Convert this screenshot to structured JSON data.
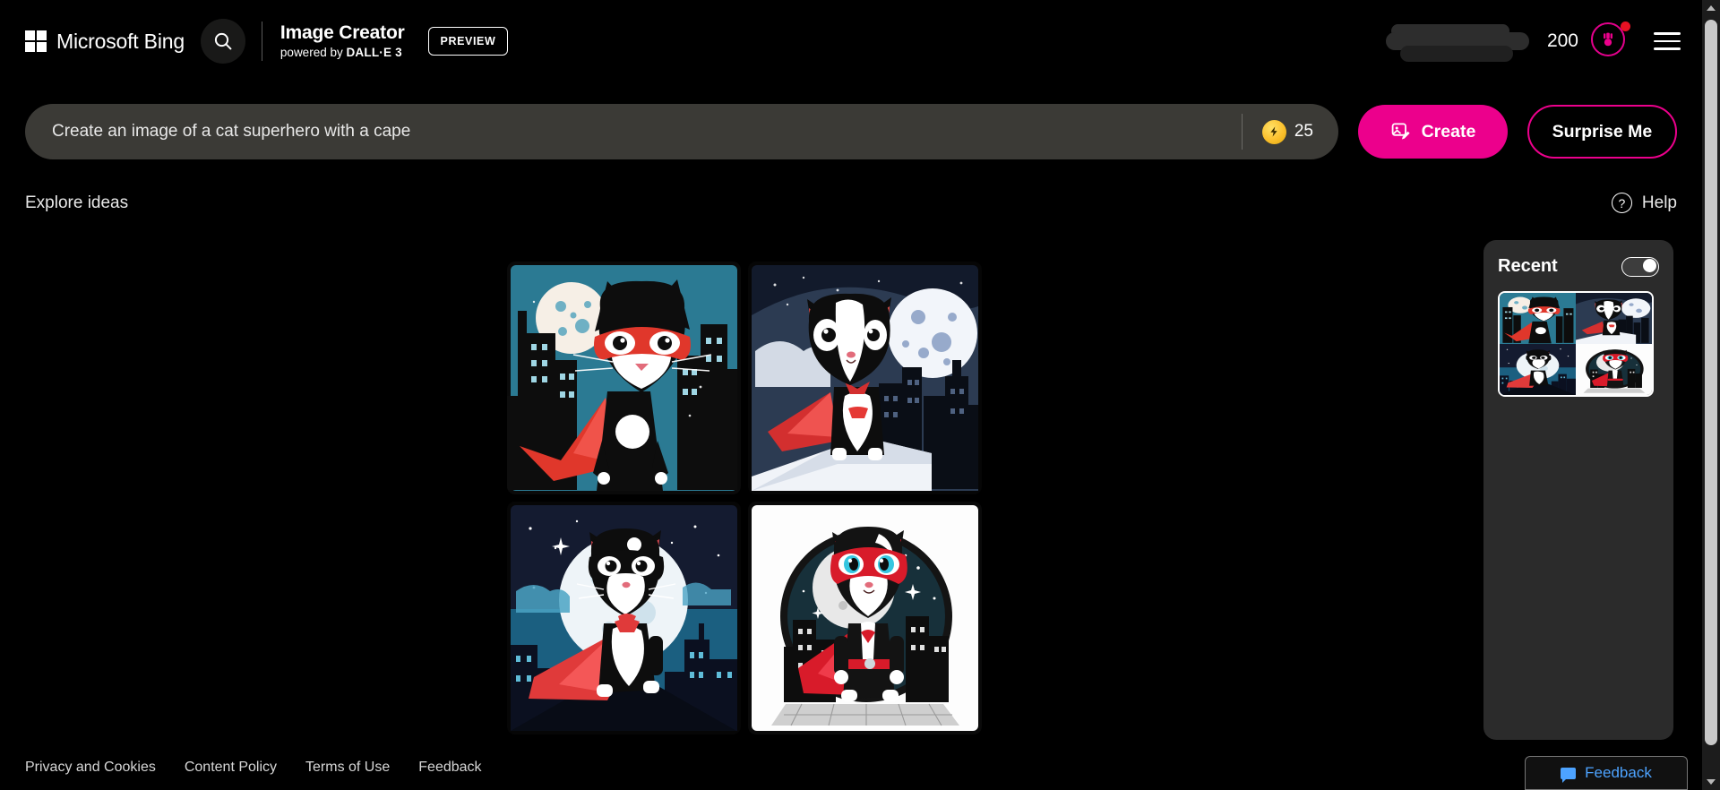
{
  "header": {
    "brand": "Microsoft Bing",
    "app_title": "Image Creator",
    "app_subtitle_prefix": "powered by ",
    "app_subtitle_strong": "DALL·E 3",
    "preview_badge": "PREVIEW",
    "credits": "200",
    "search_icon": "search-icon",
    "rewards_icon": "rewards-medal-icon",
    "menu_icon": "hamburger-menu-icon",
    "user_name_redacted": ""
  },
  "prompt": {
    "value": "Create an image of a cat superhero with a cape",
    "placeholder": "Create an image of a cat superhero with a cape",
    "boost_count": "25",
    "boost_icon": "lightning-boost-coin-icon",
    "create_label": "Create",
    "create_icon": "image-pen-icon",
    "surprise_label": "Surprise Me"
  },
  "explore": {
    "title": "Explore ideas",
    "help_label": "Help",
    "help_icon": "question-circle-icon"
  },
  "results": {
    "tiles": [
      {
        "alt": "Teal city night, masked cat superhero with red cape and full moon",
        "theme": "teal"
      },
      {
        "alt": "Tuxedo cat superhero on rooftop with large moon and dark blue skyline",
        "theme": "navy"
      },
      {
        "alt": "Black masked cat superhero flying past white moon over blue city",
        "theme": "midnight"
      },
      {
        "alt": "Cat superhero with red mask standing on rooftop inside circular badge on white",
        "theme": "white"
      }
    ]
  },
  "recent": {
    "title": "Recent",
    "toggle_state": "on",
    "thumbnail_alt": "Recent generation set of four cat superhero images"
  },
  "footer": {
    "links": [
      "Privacy and Cookies",
      "Content Policy",
      "Terms of Use",
      "Feedback"
    ],
    "feedback_button": "Feedback",
    "feedback_icon": "speech-bubble-icon"
  },
  "colors": {
    "accent_pink": "#ec008c",
    "background": "#000000",
    "input_bg": "#3b3a36",
    "panel_bg": "#2b2b2b",
    "boost_yellow": "#fbc02d",
    "notification_red": "#e81123",
    "link_blue": "#4da3ff"
  }
}
